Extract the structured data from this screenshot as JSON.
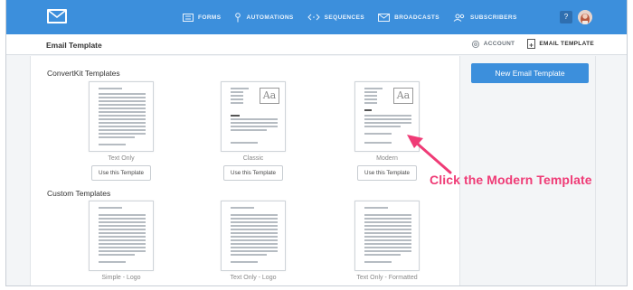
{
  "nav": {
    "items": [
      {
        "label": "FORMS",
        "icon": "forms-icon"
      },
      {
        "label": "AUTOMATIONS",
        "icon": "automations-icon"
      },
      {
        "label": "SEQUENCES",
        "icon": "sequences-icon"
      },
      {
        "label": "BROADCASTS",
        "icon": "broadcasts-icon"
      },
      {
        "label": "SUBSCRIBERS",
        "icon": "subscribers-icon"
      }
    ],
    "help_label": "?"
  },
  "subheader": {
    "title": "Email Template",
    "account_label": "ACCOUNT",
    "email_template_label": "EMAIL TEMPLATE"
  },
  "convertkit_section": {
    "title": "ConvertKit Templates",
    "templates": [
      {
        "name": "Text Only",
        "button": "Use this Template"
      },
      {
        "name": "Classic",
        "button": "Use this Template"
      },
      {
        "name": "Modern",
        "button": "Use this Template"
      }
    ]
  },
  "custom_section": {
    "title": "Custom Templates",
    "templates": [
      {
        "name": "Simple - Logo"
      },
      {
        "name": "Text Only - Logo"
      },
      {
        "name": "Text Only - Formatted"
      }
    ]
  },
  "sidebar": {
    "new_button": "New Email Template"
  },
  "annotation": {
    "text": "Click the Modern Template",
    "color": "#ef3b76"
  },
  "colors": {
    "brand_blue": "#3c8fdc"
  }
}
